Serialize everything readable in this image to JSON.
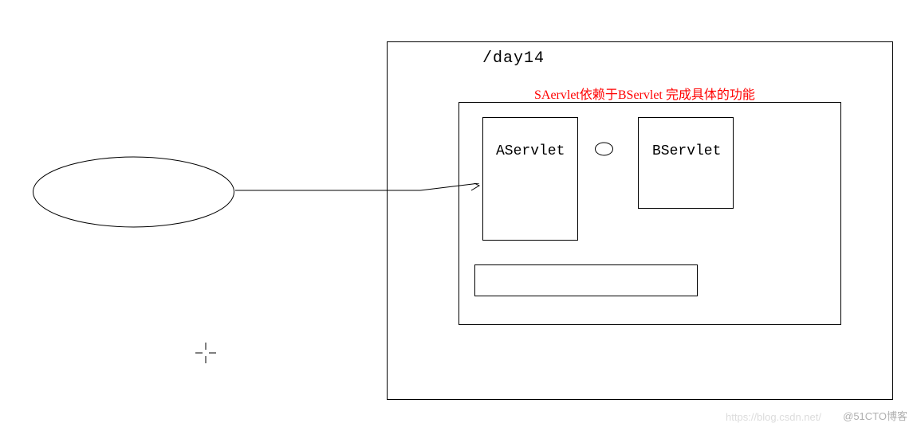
{
  "diagram": {
    "container_title": "/day14",
    "annotation": "SAervlet依赖于BServlet 完成具体的功能",
    "box_a": "AServlet",
    "box_b": "BServlet"
  },
  "watermarks": {
    "left": "https://blog.csdn.net/",
    "right": "@51CTO博客"
  },
  "chart_data": {
    "type": "diagram",
    "title": "/day14",
    "nodes": [
      {
        "id": "client",
        "shape": "ellipse",
        "label": ""
      },
      {
        "id": "day14_container",
        "shape": "rect",
        "label": "/day14"
      },
      {
        "id": "inner_container",
        "shape": "rect",
        "label": ""
      },
      {
        "id": "AServlet",
        "shape": "rect",
        "label": "AServlet"
      },
      {
        "id": "BServlet",
        "shape": "rect",
        "label": "BServlet"
      },
      {
        "id": "bottom_box",
        "shape": "rect",
        "label": ""
      }
    ],
    "edges": [
      {
        "from": "client",
        "to": "AServlet",
        "style": "arrow"
      },
      {
        "from": "AServlet",
        "to": "BServlet",
        "style": "ellipse-connector"
      }
    ],
    "annotations": [
      {
        "text": "SAervlet依赖于BServlet 完成具体的功能",
        "color": "#ff0000"
      }
    ]
  }
}
